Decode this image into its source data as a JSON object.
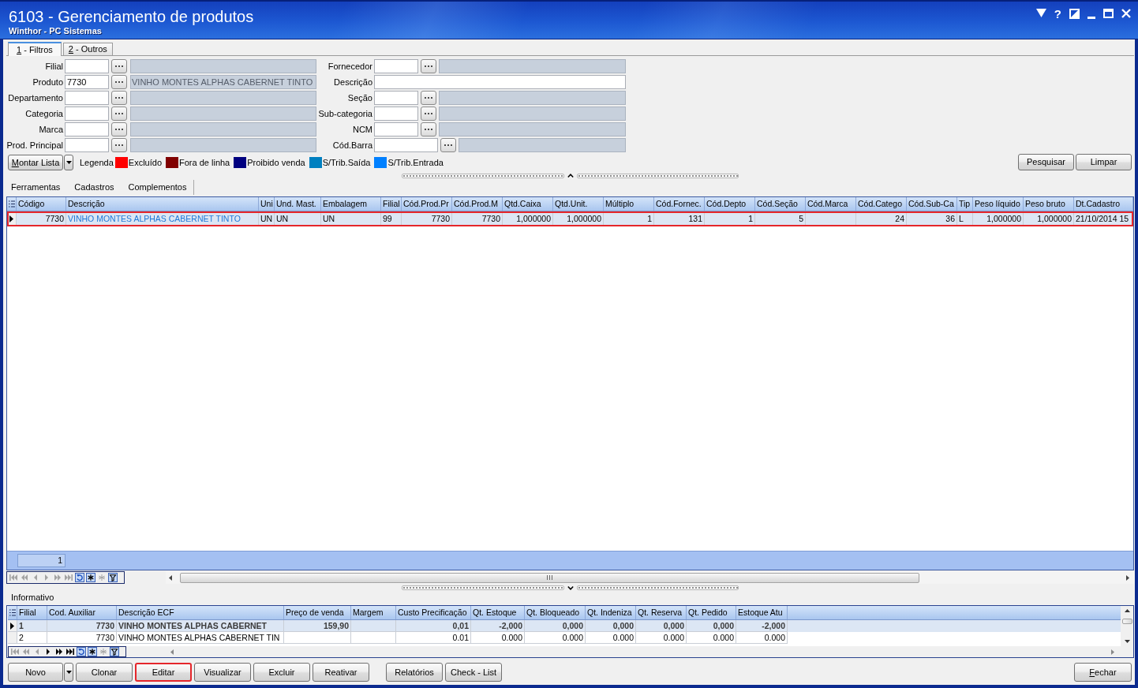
{
  "window": {
    "title": "6103 - Gerenciamento de produtos",
    "subtitle": "Winthor - PC Sistemas",
    "help_glyph": "?"
  },
  "tabs": [
    {
      "label": "1 - Filtros",
      "selected": true,
      "mnemonic": true
    },
    {
      "label": "2 - Outros",
      "selected": false,
      "mnemonic": true
    }
  ],
  "filters": {
    "left": [
      {
        "kind": "lookup",
        "label": "Filial"
      },
      {
        "kind": "lookup",
        "label": "Produto",
        "value": "7730",
        "description": "VINHO MONTES ALPHAS CABERNET TINTO"
      },
      {
        "kind": "lookup",
        "label": "Departamento"
      },
      {
        "kind": "lookup",
        "label": "Categoria"
      },
      {
        "kind": "lookup",
        "label": "Marca"
      },
      {
        "kind": "lookup",
        "label": "Prod. Principal"
      }
    ],
    "right": [
      {
        "kind": "lookup",
        "label": "Fornecedor"
      },
      {
        "kind": "text",
        "label": "Descrição"
      },
      {
        "kind": "lookup",
        "label": "Seção"
      },
      {
        "kind": "lookup",
        "label": "Sub-categoria"
      },
      {
        "kind": "lookup",
        "label": "NCM"
      },
      {
        "kind": "barcode",
        "label": "Cód.Barra"
      }
    ]
  },
  "toolbar": {
    "list_button": {
      "label": "Montar Lista",
      "kind": "split",
      "mnemonic": true
    },
    "legend_title": "Legenda",
    "legend": [
      {
        "label": "Excluído",
        "color": "#ff0000"
      },
      {
        "label": "Fora de linha",
        "color": "#800000"
      },
      {
        "label": "Proibido venda",
        "color": "#000080"
      },
      {
        "label": "S/Trib.Saída",
        "color": "#0080c0"
      },
      {
        "label": "S/Trib.Entrada",
        "color": "#0080ff"
      }
    ],
    "buttons": [
      {
        "label": "Pesquisar",
        "mnemonic": false
      },
      {
        "label": "Limpar",
        "mnemonic": false
      }
    ]
  },
  "menu": [
    "Ferramentas",
    "Cadastros",
    "Complementos"
  ],
  "grid": {
    "columns": [
      {
        "label": "Código",
        "kind": "number"
      },
      {
        "label": "Descrição",
        "kind": "name"
      },
      {
        "label": "Uni",
        "kind": "text"
      },
      {
        "label": "Und. Mast.",
        "kind": "text"
      },
      {
        "label": "Embalagem",
        "kind": "text"
      },
      {
        "label": "Filial",
        "kind": "text"
      },
      {
        "label": "Cód.Prod.Pr",
        "kind": "number"
      },
      {
        "label": "Cód.Prod.M",
        "kind": "number"
      },
      {
        "label": "Qtd.Caixa",
        "kind": "number"
      },
      {
        "label": "Qtd.Unit.",
        "kind": "number"
      },
      {
        "label": "Múltiplo",
        "kind": "number"
      },
      {
        "label": "Cód.Fornec.",
        "kind": "number"
      },
      {
        "label": "Cód.Depto",
        "kind": "number"
      },
      {
        "label": "Cód.Seção",
        "kind": "number"
      },
      {
        "label": "Cód.Marca",
        "kind": "number"
      },
      {
        "label": "Cód.Catego",
        "kind": "number"
      },
      {
        "label": "Cód.Sub-Ca",
        "kind": "number"
      },
      {
        "label": "Tip",
        "kind": "text"
      },
      {
        "label": "Peso líquido",
        "kind": "number"
      },
      {
        "label": "Peso bruto",
        "kind": "number"
      },
      {
        "label": "Dt.Cadastro",
        "kind": "text"
      }
    ],
    "rows": [
      {
        "selected": true,
        "highlighted": true,
        "color": "#1e78d8",
        "cells": [
          "7730",
          "VINHO MONTES ALPHAS CABERNET TINTO",
          "UN",
          "UN",
          "UN",
          "99",
          "7730",
          "7730",
          "1,000000",
          "1,000000",
          "1",
          "131",
          "1",
          "5",
          null,
          "24",
          "36",
          "L",
          "1,000000",
          "1,000000",
          "21/10/2014 15"
        ]
      }
    ],
    "footer_count": "1"
  },
  "grid_navigator": [
    {
      "kind": "first",
      "disabled": true
    },
    {
      "kind": "prior_page",
      "disabled": true
    },
    {
      "kind": "prior",
      "disabled": true
    },
    {
      "kind": "next",
      "disabled": true
    },
    {
      "kind": "next_page",
      "disabled": true
    },
    {
      "kind": "last",
      "disabled": true
    },
    {
      "kind": "refresh",
      "disabled": false
    },
    {
      "kind": "insert",
      "disabled": false
    },
    {
      "kind": "clear",
      "disabled": true
    },
    {
      "kind": "filter",
      "disabled": false
    }
  ],
  "info": {
    "title": "Informativo",
    "columns": [
      {
        "label": "Filial",
        "kind": "text"
      },
      {
        "label": "Cod. Auxiliar",
        "kind": "number"
      },
      {
        "label": "Descrição ECF",
        "kind": "text"
      },
      {
        "label": "Preço de venda",
        "kind": "number"
      },
      {
        "label": "Margem",
        "kind": "number"
      },
      {
        "label": "Custo Precificação",
        "kind": "number"
      },
      {
        "label": "Qt. Estoque",
        "kind": "number"
      },
      {
        "label": "Qt. Bloqueado",
        "kind": "number"
      },
      {
        "label": "Qt. Indeniza",
        "kind": "number"
      },
      {
        "label": "Qt. Reserva",
        "kind": "number"
      },
      {
        "label": "Qt. Pedido",
        "kind": "number"
      },
      {
        "label": "Estoque Atu",
        "kind": "number"
      }
    ],
    "rows": [
      {
        "selected": true,
        "cells": [
          "1",
          "7730",
          "VINHO MONTES ALPHAS CABERNET",
          "159,90",
          null,
          "0,01",
          "-2,000",
          "0,000",
          "0,000",
          "0,000",
          "0,000",
          "-2,000"
        ]
      },
      {
        "selected": false,
        "cells": [
          "2",
          "7730",
          "VINHO MONTES ALPHAS CABERNET TIN",
          null,
          null,
          "0.01",
          "0.000",
          "0.000",
          "0.000",
          "0.000",
          "0.000",
          "0.000"
        ]
      }
    ]
  },
  "info_navigator": [
    {
      "kind": "first",
      "disabled": true
    },
    {
      "kind": "prior_page",
      "disabled": true
    },
    {
      "kind": "prior",
      "disabled": true
    },
    {
      "kind": "next",
      "disabled": false
    },
    {
      "kind": "next_page",
      "disabled": false
    },
    {
      "kind": "last",
      "disabled": false
    },
    {
      "kind": "refresh",
      "disabled": false
    },
    {
      "kind": "insert",
      "disabled": false
    },
    {
      "kind": "clear",
      "disabled": true
    },
    {
      "kind": "filter",
      "disabled": false
    }
  ],
  "actions": [
    [
      {
        "label": "Novo",
        "kind": "split",
        "highlighted": false
      },
      {
        "label": "Clonar",
        "kind": "plain",
        "highlighted": false
      },
      {
        "label": "Editar",
        "kind": "plain",
        "highlighted": true
      },
      {
        "label": "Visualizar",
        "kind": "plain",
        "highlighted": false
      },
      {
        "label": "Excluir",
        "kind": "plain",
        "highlighted": false
      },
      {
        "label": "Reativar",
        "kind": "plain",
        "highlighted": false
      }
    ],
    [
      {
        "label": "Relatórios",
        "kind": "plain",
        "highlighted": false
      },
      {
        "label": "Check - List",
        "kind": "plain",
        "highlighted": false
      }
    ]
  ],
  "close_button": {
    "label": "Fechar",
    "mnemonic": true
  }
}
